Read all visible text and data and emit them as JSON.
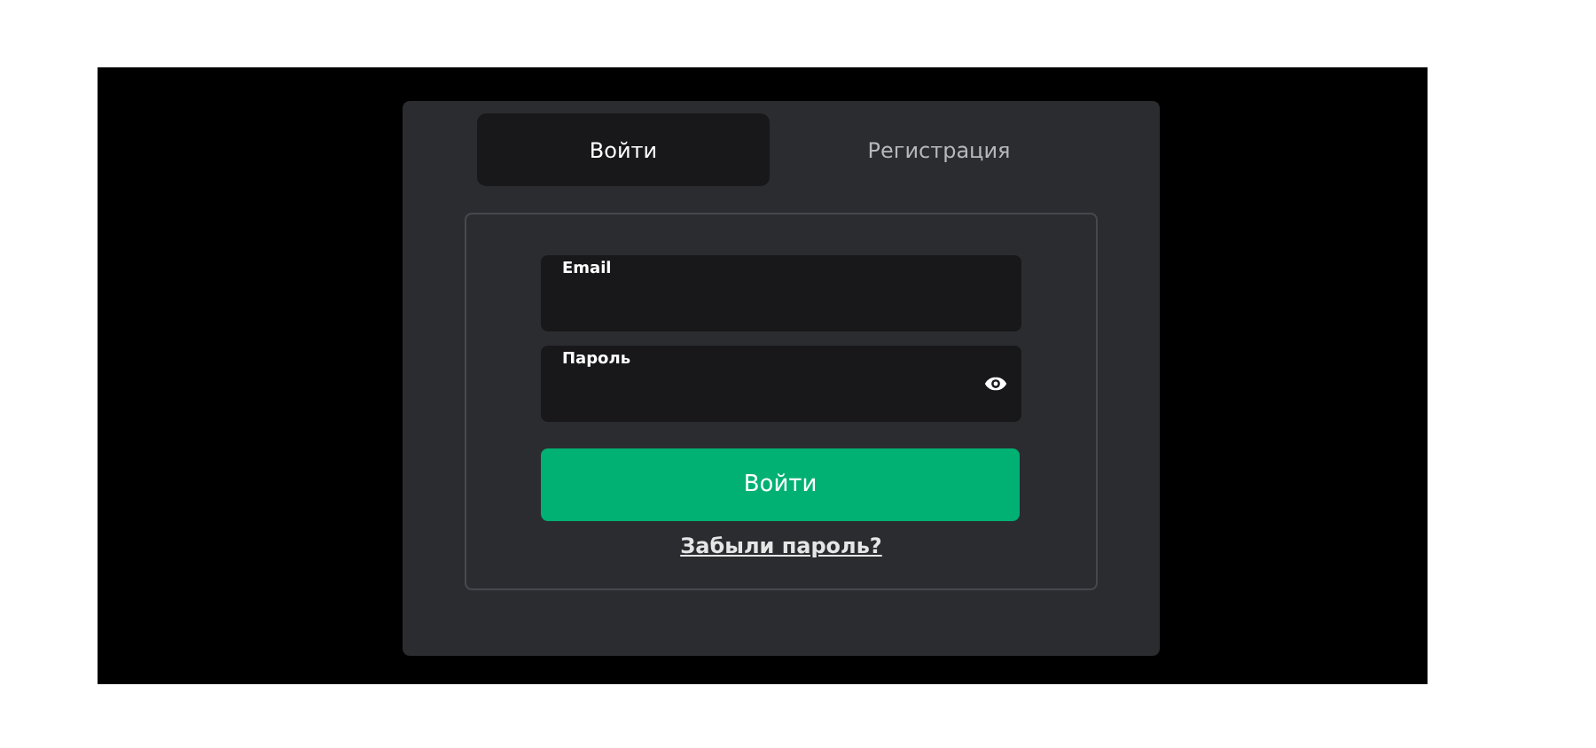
{
  "tabs": [
    {
      "label": "Войти",
      "selected": true
    },
    {
      "label": "Регистрация",
      "selected": false
    }
  ],
  "form": {
    "fields": [
      {
        "label": "Email",
        "reveal_toggle": false
      },
      {
        "label": "Пароль",
        "reveal_toggle": true
      }
    ],
    "submit": "Войти",
    "forgot_link": "Забыли пароль?"
  }
}
